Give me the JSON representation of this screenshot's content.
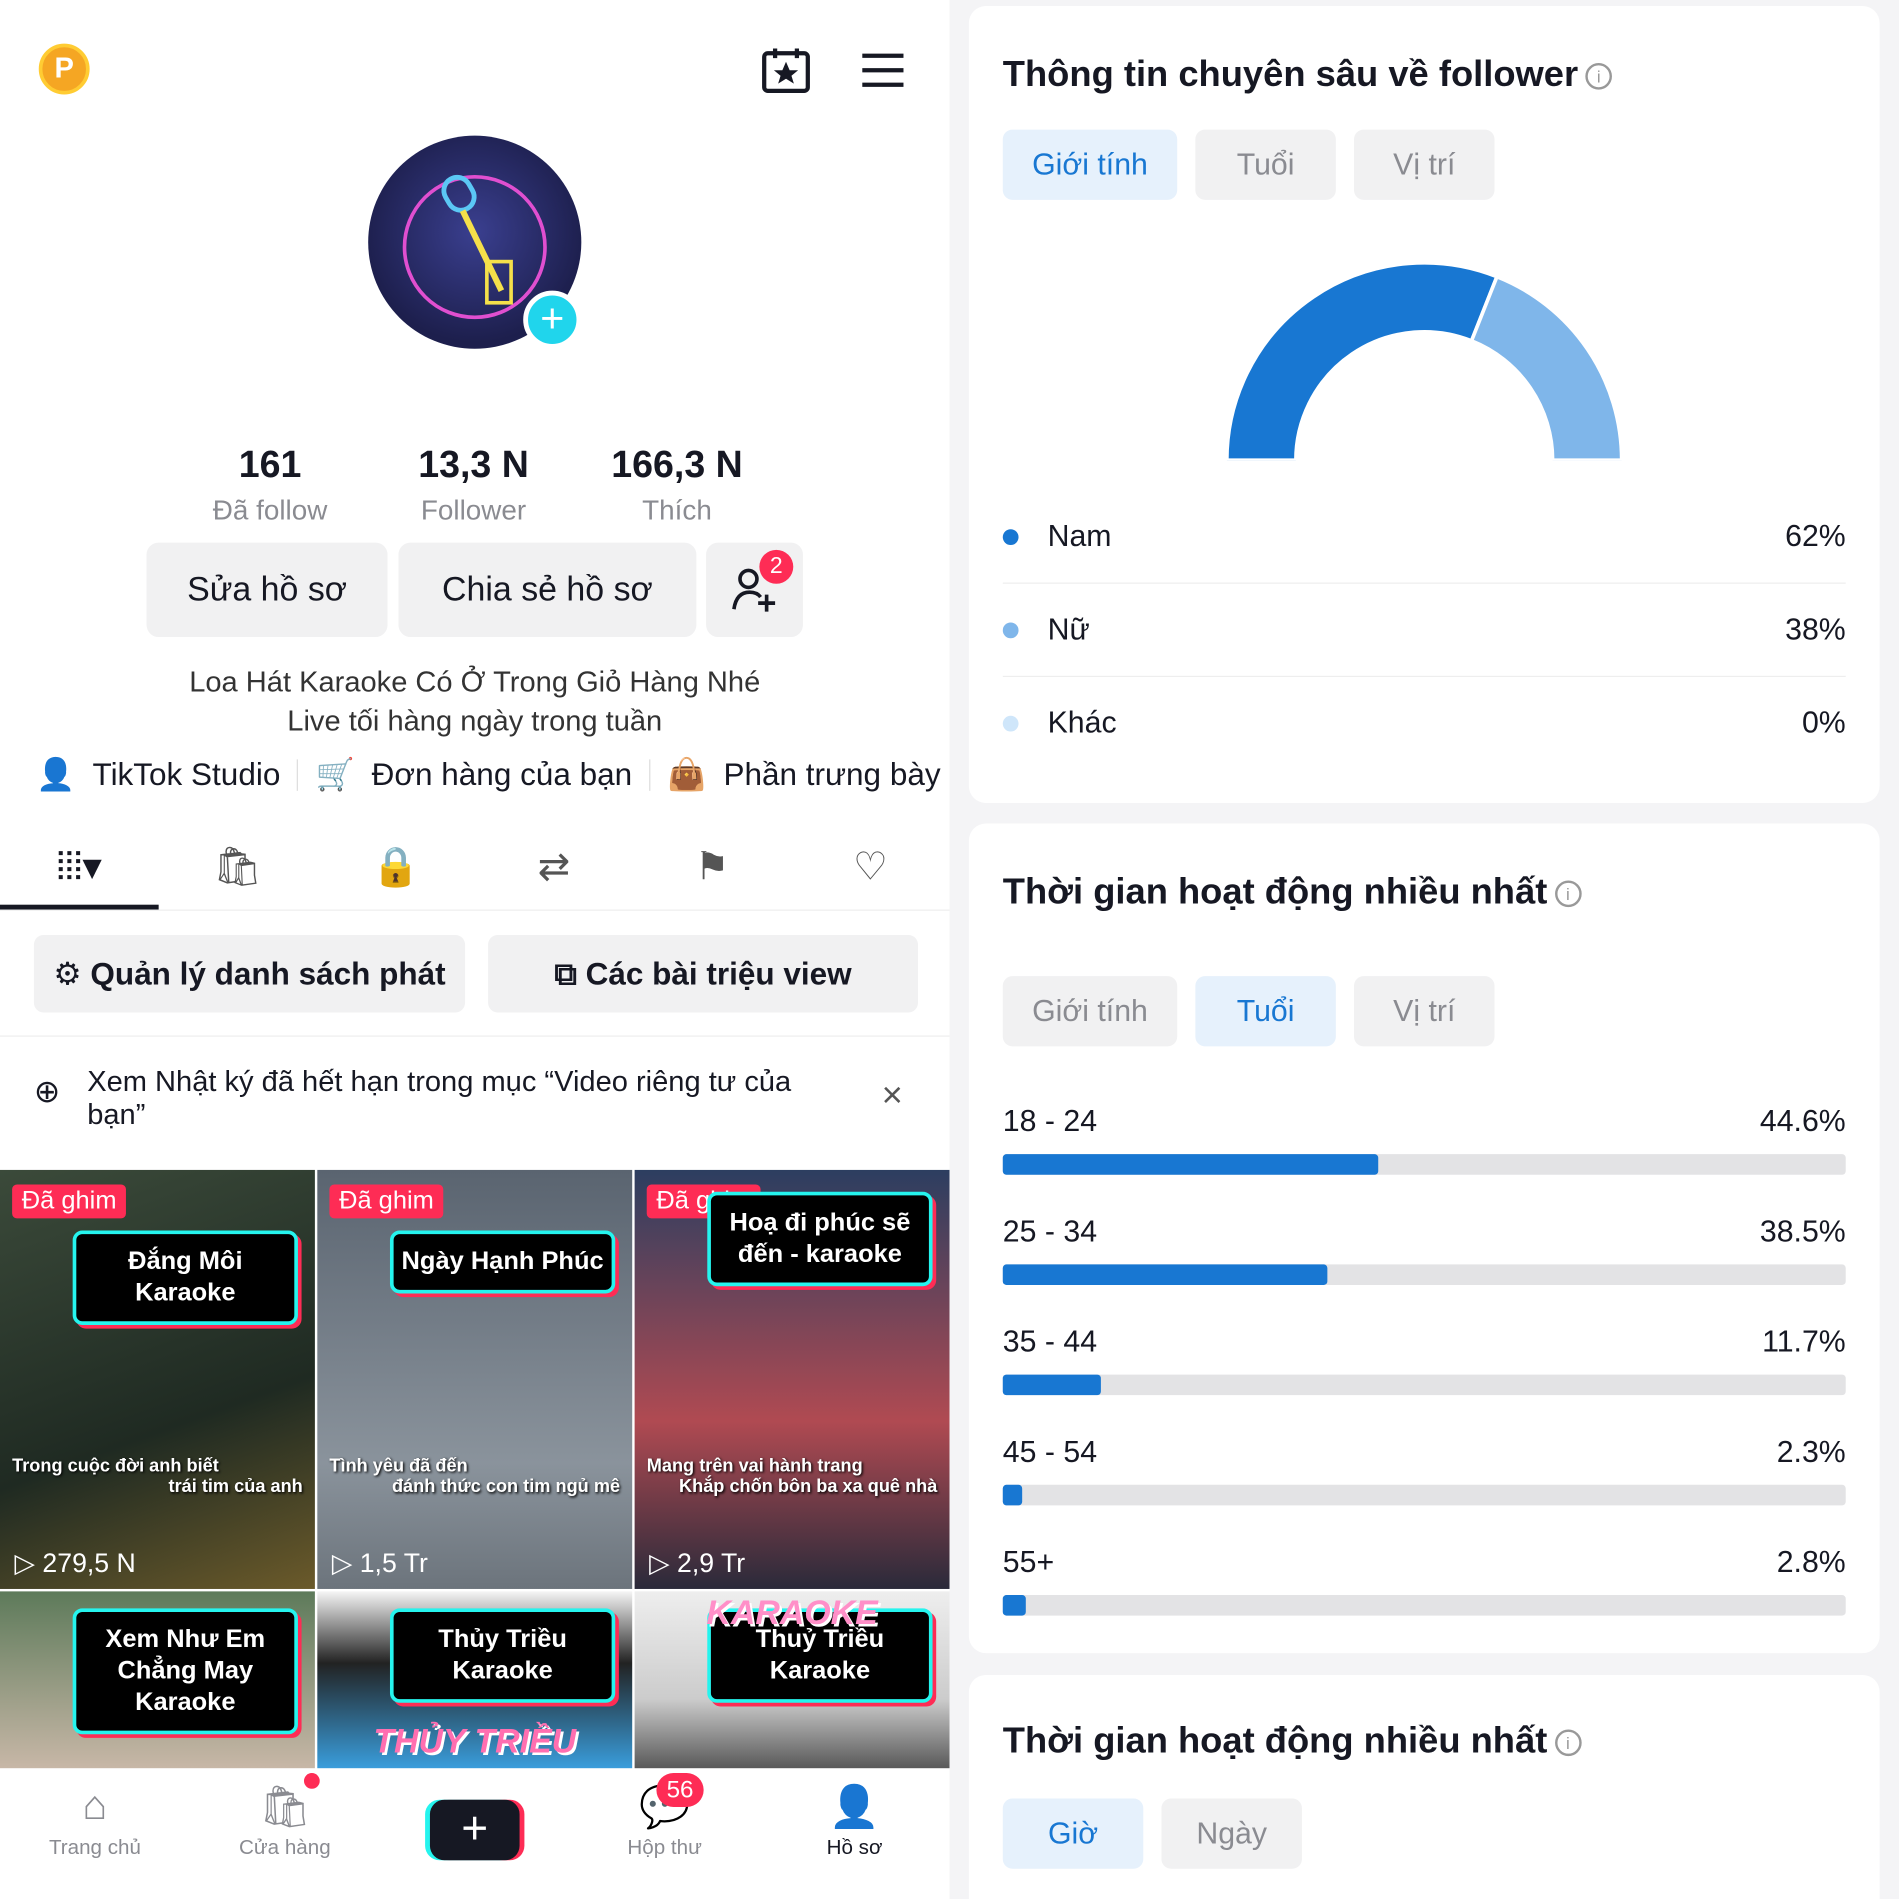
{
  "header": {
    "coin_label": "P",
    "calendar_icon": "calendar-star-icon",
    "menu_icon": "hamburger-icon"
  },
  "profile": {
    "stats": [
      {
        "value": "161",
        "label": "Đã follow"
      },
      {
        "value": "13,3 N",
        "label": "Follower"
      },
      {
        "value": "166,3 N",
        "label": "Thích"
      }
    ],
    "edit_label": "Sửa hồ sơ",
    "share_label": "Chia sẻ hồ sơ",
    "add_friend_badge": "2",
    "bio_line1": "Loa Hát Karaoke Có Ở Trong Giỏ Hàng Nhé",
    "bio_line2": "Live tối hàng ngày trong tuần",
    "links": [
      "TikTok Studio",
      "Đơn hàng của bạn",
      "Phần trưng bày"
    ]
  },
  "playlist": {
    "manage_label": "Quản lý danh sách phát",
    "million_label": "Các bài triệu view"
  },
  "notice": {
    "text": "Xem Nhật ký đã hết hạn trong mục “Video riêng tư của bạn”",
    "close": "×"
  },
  "videos": [
    {
      "pinned": "Đã ghim",
      "title": "Đắng Môi Karaoke",
      "lyric1": "Trong cuộc đời anh biết",
      "lyric2": "trái tim của anh",
      "views": "279,5 N",
      "bg": "linear-gradient(160deg,#3b4a3a,#1f2a22 60%,#6b5a2a)"
    },
    {
      "pinned": "Đã ghim",
      "title": "Ngày Hạnh Phúc",
      "lyric1": "Tình yêu đã đến",
      "lyric2": "đánh thức con tim ngủ mê",
      "views": "1,5 Tr",
      "bg": "linear-gradient(180deg,#5a6470,#8a939c 70%,#6c747c)"
    },
    {
      "pinned": "Đã ghim",
      "title": "Hoạ đi phúc sẽ đến - karaoke",
      "lyric1": "Mang trên vai hành trang",
      "lyric2": "Khắp chốn bôn ba xa quê nhà",
      "views": "2,9 Tr",
      "bg": "linear-gradient(180deg,#2c3e60,#b04a52 60%,#2a2a3a)"
    },
    {
      "title": "Xem Như Em Chẳng May Karaoke",
      "bg": "linear-gradient(180deg,#5d7a5a,#c9b8a8)"
    },
    {
      "title": "Thủy Triều Karaoke",
      "banner": "THỦY TRIỀU",
      "bg": "linear-gradient(180deg,#f5f5f5,#222 40%,#3aa0e0)"
    },
    {
      "title": "Thuỷ Triều Karaoke",
      "banner": "KARAOKE",
      "bg": "linear-gradient(180deg,#eee,#ccc 60%,#555)"
    }
  ],
  "nav": [
    {
      "label": "Trang chủ",
      "icon": "home-icon"
    },
    {
      "label": "Cửa hàng",
      "icon": "shop-bag-icon"
    },
    {
      "label": "",
      "icon": "plus-icon"
    },
    {
      "label": "Hộp thư",
      "icon": "inbox-icon",
      "badge": "56"
    },
    {
      "label": "Hồ sơ",
      "icon": "profile-icon"
    }
  ],
  "insights": {
    "title": "Thông tin chuyên sâu về follower",
    "tabs": [
      "Giới tính",
      "Tuổi",
      "Vị trí"
    ],
    "active_tab": "Giới tính",
    "chart_data": {
      "type": "pie",
      "variant": "half-donut",
      "categories": [
        "Nam",
        "Nữ",
        "Khác"
      ],
      "values": [
        62,
        38,
        0
      ],
      "labels": [
        "62%",
        "38%",
        "0%"
      ],
      "colors": [
        "#1877d2",
        "#7fb6ea",
        "#cfe6fa"
      ]
    }
  },
  "activity_age": {
    "title": "Thời gian hoạt động nhiều nhất",
    "tabs": [
      "Giới tính",
      "Tuổi",
      "Vị trí"
    ],
    "active_tab": "Tuổi",
    "chart_data": {
      "type": "bar",
      "orientation": "horizontal",
      "categories": [
        "18 - 24",
        "25 - 34",
        "35 - 44",
        "45 - 54",
        "55+"
      ],
      "values": [
        44.6,
        38.5,
        11.7,
        2.3,
        2.8
      ],
      "labels": [
        "44.6%",
        "38.5%",
        "11.7%",
        "2.3%",
        "2.8%"
      ],
      "xlim": [
        0,
        100
      ],
      "color": "#1877d2"
    }
  },
  "activity_time": {
    "title": "Thời gian hoạt động nhiều nhất",
    "tabs": [
      "Giờ",
      "Ngày"
    ],
    "active_tab": "Giờ"
  }
}
